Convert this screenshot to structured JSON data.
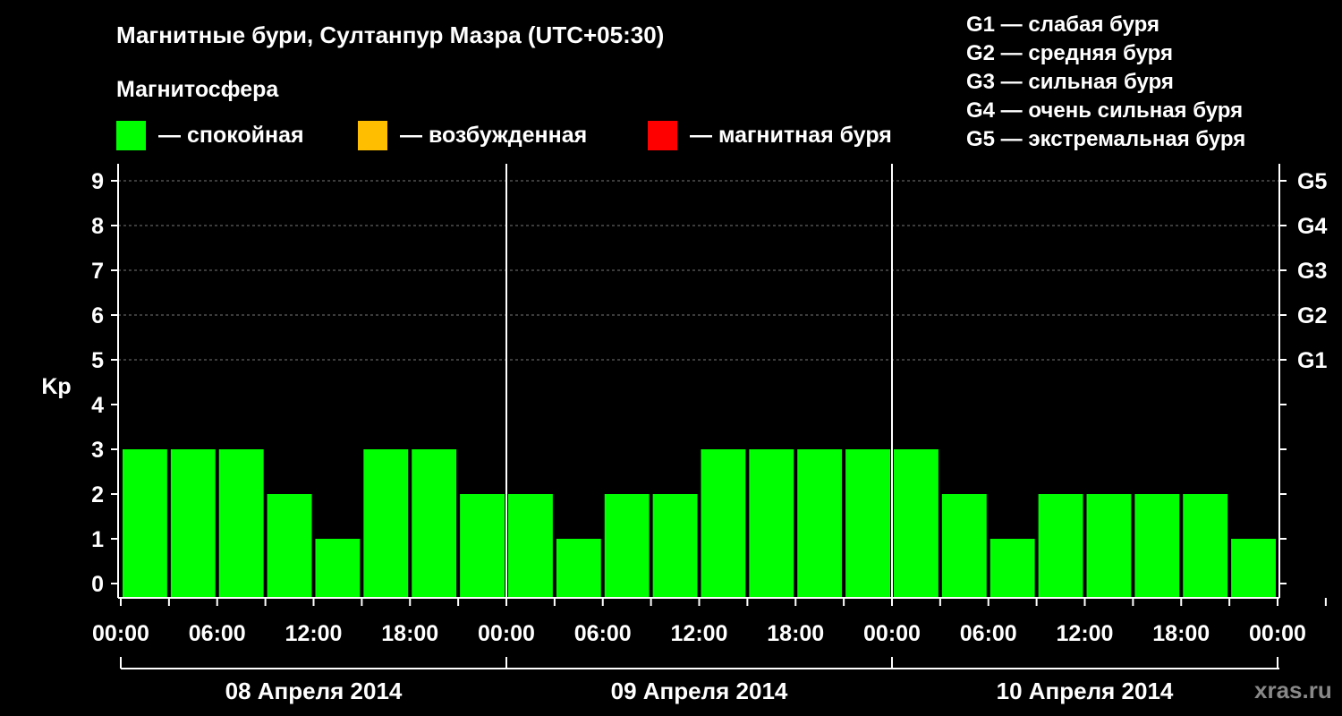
{
  "title": "Магнитные бури, Султанпур Мазра (UTC+05:30)",
  "legend": {
    "heading": "Магнитосфера",
    "items": [
      {
        "label": "— спокойная",
        "color": "#00ff00"
      },
      {
        "label": "— возбужденная",
        "color": "#ffbf00"
      },
      {
        "label": "— магнитная буря",
        "color": "#ff0000"
      }
    ]
  },
  "g_scale": [
    "G1 — слабая буря",
    "G2 — средняя буря",
    "G3 — сильная буря",
    "G4 — очень сильная буря",
    "G5 — экстремальная буря"
  ],
  "watermark": "xras.ru",
  "chart_data": {
    "type": "bar",
    "ylabel": "Kp",
    "ylim": [
      0,
      9
    ],
    "yticks": [
      "0",
      "1",
      "2",
      "3",
      "4",
      "5",
      "6",
      "7",
      "8",
      "9"
    ],
    "right_ticks": [
      {
        "y": 5,
        "label": "G1"
      },
      {
        "y": 6,
        "label": "G2"
      },
      {
        "y": 7,
        "label": "G3"
      },
      {
        "y": 8,
        "label": "G4"
      },
      {
        "y": 9,
        "label": "G5"
      }
    ],
    "xticks": [
      "00:00",
      "06:00",
      "12:00",
      "18:00",
      "00:00",
      "06:00",
      "12:00",
      "18:00",
      "00:00",
      "06:00",
      "12:00",
      "18:00",
      "00:00"
    ],
    "days": [
      "08 Апреля 2014",
      "09 Апреля 2014",
      "10 Апреля 2014"
    ],
    "interval_hours": 3,
    "grid": "dashed horizontal at Kp 5-9",
    "bar_color": "#00ff00",
    "values": [
      2,
      2,
      2,
      1,
      0,
      2,
      2,
      1,
      1,
      0,
      1,
      1,
      2,
      2,
      2,
      2,
      2,
      1,
      0,
      1,
      1,
      1,
      1,
      0,
      1
    ]
  }
}
